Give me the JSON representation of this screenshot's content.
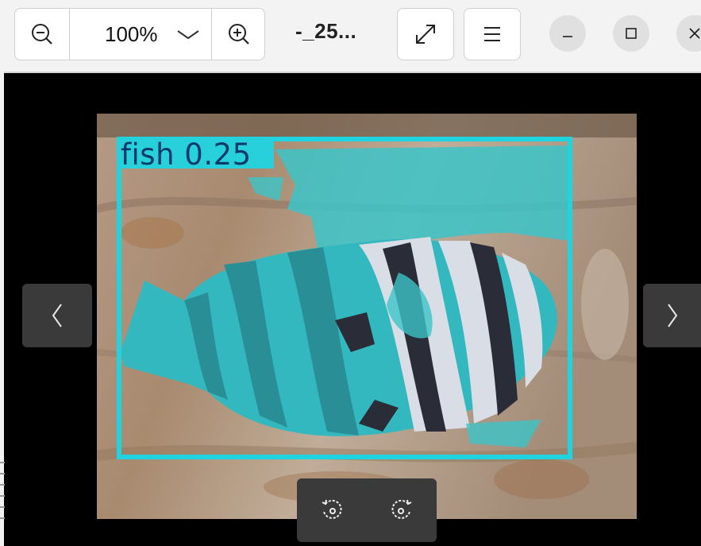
{
  "toolbar": {
    "zoom_value": "100%",
    "filename": "-_25..."
  },
  "detection": {
    "label": "fish 0.25",
    "box_color": "#1fd4e0"
  },
  "icons": {
    "zoom_out": "zoom-out-icon",
    "zoom_in": "zoom-in-icon",
    "chevron": "chevron-down-icon",
    "fullscreen": "fullscreen-icon",
    "menu": "hamburger-menu-icon",
    "minimize": "minimize-icon",
    "maximize": "maximize-icon",
    "close": "close-icon",
    "prev": "chevron-left-icon",
    "next": "chevron-right-icon",
    "rotate_left": "rotate-left-icon",
    "rotate_right": "rotate-right-icon"
  }
}
